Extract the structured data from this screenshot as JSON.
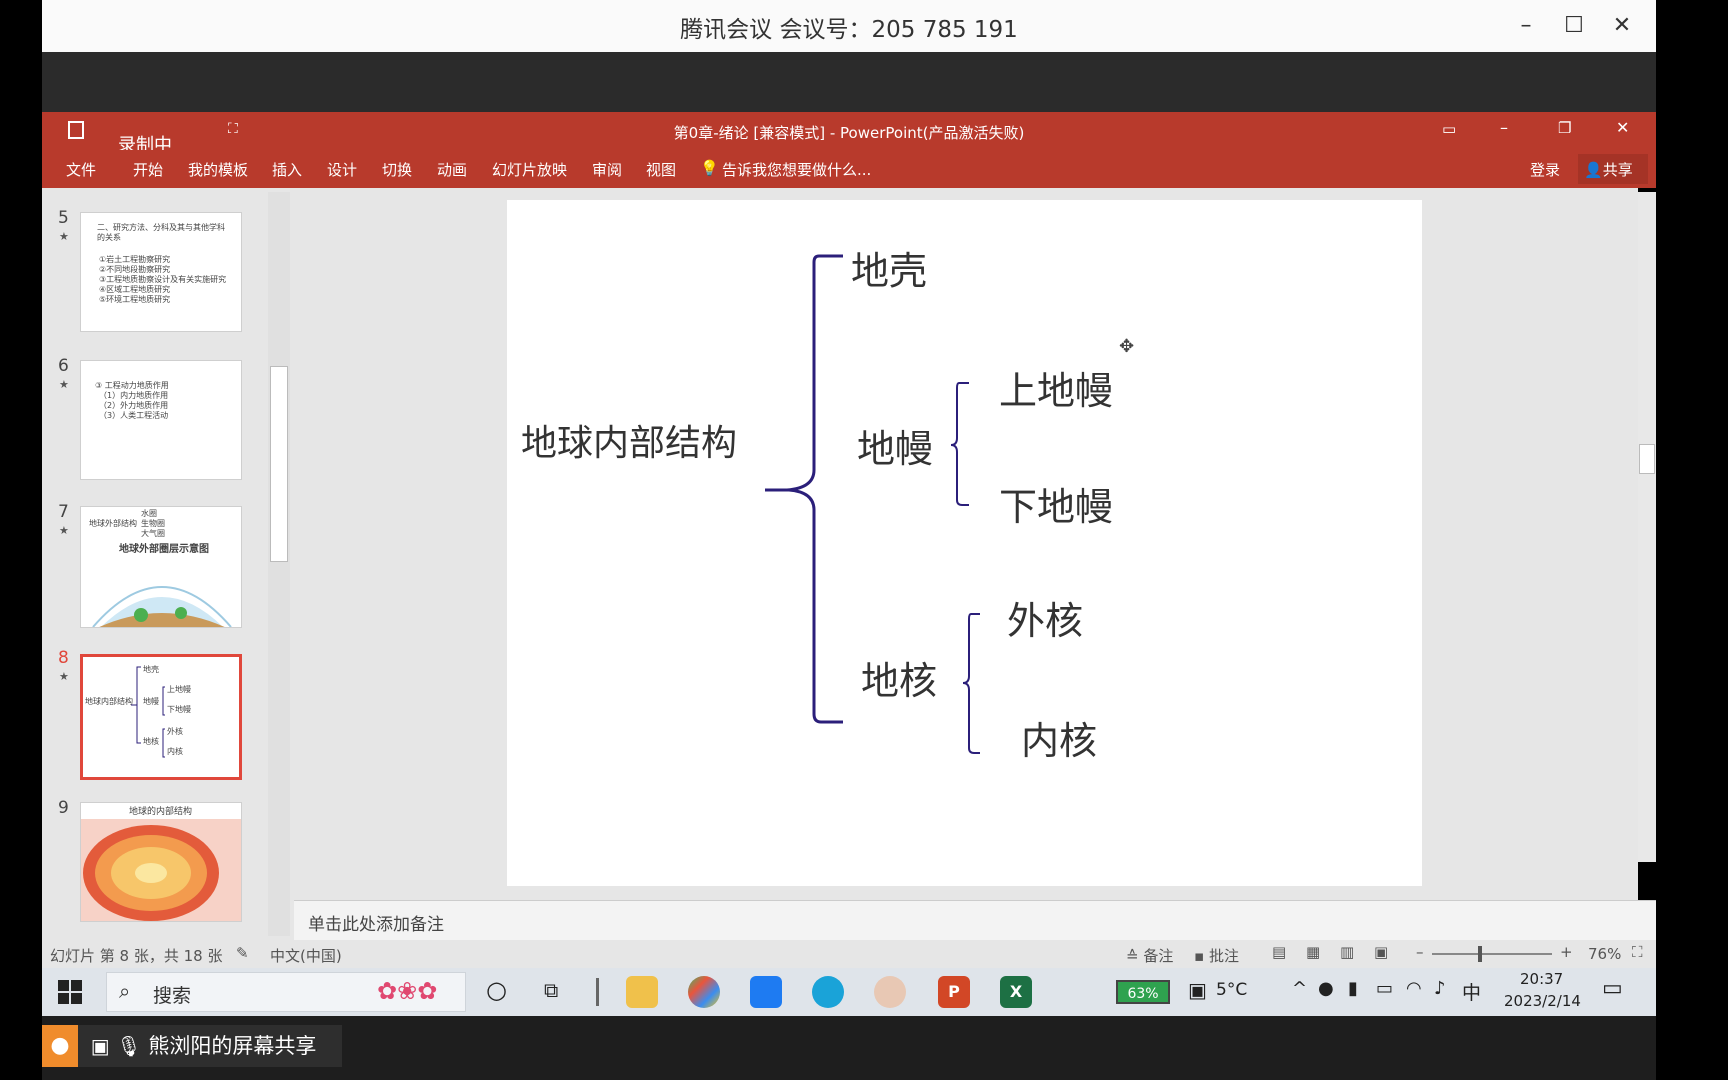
{
  "meeting": {
    "title": "腾讯会议 会议号：205 785 191"
  },
  "ppt": {
    "window_title": "第0章-绪论 [兼容模式] - PowerPoint(产品激活失败)",
    "recording_badge": "录制中",
    "ribbon": [
      "文件",
      "开始",
      "我的模板",
      "插入",
      "设计",
      "切换",
      "动画",
      "幻灯片放映",
      "审阅",
      "视图"
    ],
    "tell_me": "告诉我您想要做什么...",
    "login": "登录",
    "share": "共享"
  },
  "thumbnails": [
    {
      "num": "5",
      "lines": [
        "二、研究方法、分科及其与其他学科的关系",
        "①岩土工程勘察研究",
        "②不同地段勘察研究",
        "③工程地质勘察设计及有关实施研究",
        "④区域工程地质研究",
        "⑤环境工程地质研究"
      ]
    },
    {
      "num": "6",
      "lines": [
        "③ 工程动力地质作用",
        "（1）内力地质作用",
        "（2）外力地质作用",
        "（3）人类工程活动"
      ]
    },
    {
      "num": "7",
      "title": "地球外部圈层示意图",
      "lines": [
        "地球外部结构",
        "水圈",
        "生物圈",
        "大气圈"
      ]
    },
    {
      "num": "8",
      "lines": [
        "地球内部结构",
        "地壳",
        "地幔",
        "上地幔",
        "下地幔",
        "地核",
        "外核",
        "内核"
      ]
    },
    {
      "num": "9",
      "title": "地球的内部结构"
    }
  ],
  "slide": {
    "root": "地球内部结构",
    "crust": "地壳",
    "mantle": "地幔",
    "upper_mantle": "上地幔",
    "lower_mantle": "下地幔",
    "core": "地核",
    "outer_core": "外核",
    "inner_core": "内核",
    "bracket_color": "#2b1f7a"
  },
  "notes_placeholder": "单击此处添加备注",
  "status": {
    "slide_info": "幻灯片 第 8 张，共 18 张",
    "language": "中文(中国)",
    "notes_btn": "备注",
    "comments_btn": "批注",
    "zoom": "76%"
  },
  "taskbar": {
    "search": "搜索",
    "battery": "63%",
    "weather": "5°C",
    "ime": "中",
    "time": "20:37",
    "date": "2023/2/14"
  },
  "share_bar": {
    "label": "熊浏阳的屏幕共享"
  }
}
